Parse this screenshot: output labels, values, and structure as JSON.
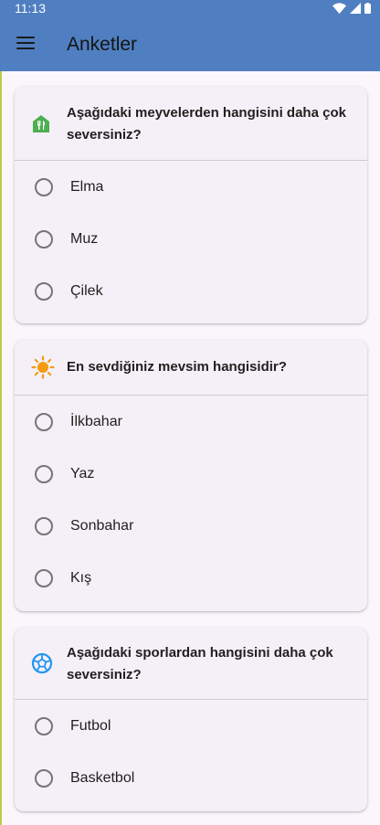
{
  "status_bar": {
    "time": "11:13"
  },
  "app_bar": {
    "title": "Anketler",
    "menu_icon": "menu-icon"
  },
  "polls": [
    {
      "icon": "restaurant-icon",
      "question": "Aşağıdaki meyvelerden hangisini daha çok seversiniz?",
      "options": [
        "Elma",
        "Muz",
        "Çilek"
      ]
    },
    {
      "icon": "sun-icon",
      "question": "En sevdiğiniz mevsim hangisidir?",
      "options": [
        "İlkbahar",
        "Yaz",
        "Sonbahar",
        "Kış"
      ]
    },
    {
      "icon": "soccer-ball-icon",
      "question": "Aşağıdaki sporlardan hangisini daha çok seversiniz?",
      "options": [
        "Futbol",
        "Basketbol"
      ]
    }
  ],
  "colors": {
    "app_bar": "#4f7fc1",
    "background": "#fbf6fc",
    "card": "#f5f0f7",
    "restaurant_icon": "#4caf50",
    "sun_icon": "#f39c12",
    "soccer_icon": "#2196f3"
  }
}
